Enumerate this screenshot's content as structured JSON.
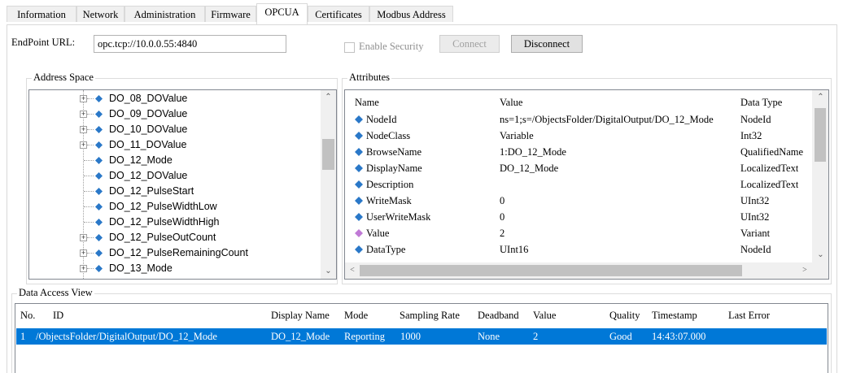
{
  "tabs": [
    {
      "label": "Information"
    },
    {
      "label": "Network"
    },
    {
      "label": "Administration"
    },
    {
      "label": "Firmware"
    },
    {
      "label": "OPCUA"
    },
    {
      "label": "Certificates"
    },
    {
      "label": "Modbus Address"
    }
  ],
  "active_tab": "OPCUA",
  "endpoint": {
    "label": "EndPoint URL:",
    "value": "opc.tcp://10.0.0.55:4840"
  },
  "enable_security": {
    "label": "Enable Security",
    "checked": false
  },
  "buttons": {
    "connect": "Connect",
    "disconnect": "Disconnect"
  },
  "address_space": {
    "title": "Address Space",
    "items": [
      {
        "label": "DO_08_DOValue",
        "expandable": true,
        "icon": "variable-node-icon"
      },
      {
        "label": "DO_09_DOValue",
        "expandable": true,
        "icon": "variable-node-icon"
      },
      {
        "label": "DO_10_DOValue",
        "expandable": true,
        "icon": "variable-node-icon"
      },
      {
        "label": "DO_11_DOValue",
        "expandable": true,
        "icon": "variable-node-icon"
      },
      {
        "label": "DO_12_Mode",
        "expandable": false,
        "icon": "variable-node-icon"
      },
      {
        "label": "DO_12_DOValue",
        "expandable": false,
        "icon": "variable-node-icon"
      },
      {
        "label": "DO_12_PulseStart",
        "expandable": false,
        "icon": "variable-node-icon"
      },
      {
        "label": "DO_12_PulseWidthLow",
        "expandable": false,
        "icon": "variable-node-icon"
      },
      {
        "label": "DO_12_PulseWidthHigh",
        "expandable": false,
        "icon": "variable-node-icon"
      },
      {
        "label": "DO_12_PulseOutCount",
        "expandable": true,
        "icon": "variable-node-icon"
      },
      {
        "label": "DO_12_PulseRemainingCount",
        "expandable": true,
        "icon": "variable-node-icon"
      },
      {
        "label": "DO_13_Mode",
        "expandable": true,
        "icon": "variable-node-icon"
      }
    ]
  },
  "attributes": {
    "title": "Attributes",
    "columns": [
      "Name",
      "Value",
      "Data Type"
    ],
    "rows": [
      {
        "name": "NodeId",
        "value": "ns=1;s=/ObjectsFolder/DigitalOutput/DO_12_Mode",
        "type": "NodeId",
        "icon": "attribute-icon"
      },
      {
        "name": "NodeClass",
        "value": "Variable",
        "type": "Int32",
        "icon": "attribute-icon"
      },
      {
        "name": "BrowseName",
        "value": "1:DO_12_Mode",
        "type": "QualifiedName",
        "icon": "attribute-icon"
      },
      {
        "name": "DisplayName",
        "value": "DO_12_Mode",
        "type": "LocalizedText",
        "icon": "attribute-icon"
      },
      {
        "name": "Description",
        "value": "",
        "type": "LocalizedText",
        "icon": "attribute-icon"
      },
      {
        "name": "WriteMask",
        "value": "0",
        "type": "UInt32",
        "icon": "attribute-icon"
      },
      {
        "name": "UserWriteMask",
        "value": "0",
        "type": "UInt32",
        "icon": "attribute-icon"
      },
      {
        "name": "Value",
        "value": "2",
        "type": "Variant",
        "icon": "value-attribute-icon"
      },
      {
        "name": "DataType",
        "value": "UInt16",
        "type": "NodeId",
        "icon": "attribute-icon"
      }
    ]
  },
  "data_access": {
    "title": "Data Access View",
    "columns": [
      "No.",
      "ID",
      "Display Name",
      "Mode",
      "Sampling Rate",
      "Deadband",
      "Value",
      "Quality",
      "Timestamp",
      "Last Error"
    ],
    "rows": [
      {
        "no": "1",
        "id": "/ObjectsFolder/DigitalOutput/DO_12_Mode",
        "display_name": "DO_12_Mode",
        "mode": "Reporting",
        "sampling_rate": "1000",
        "deadband": "None",
        "value": "2",
        "quality": "Good",
        "timestamp": "14:43:07.000",
        "last_error": ""
      }
    ]
  },
  "colors": {
    "selection": "#0078d7",
    "node_icon": "#2a78c8",
    "value_icon": "#c07ad6"
  }
}
